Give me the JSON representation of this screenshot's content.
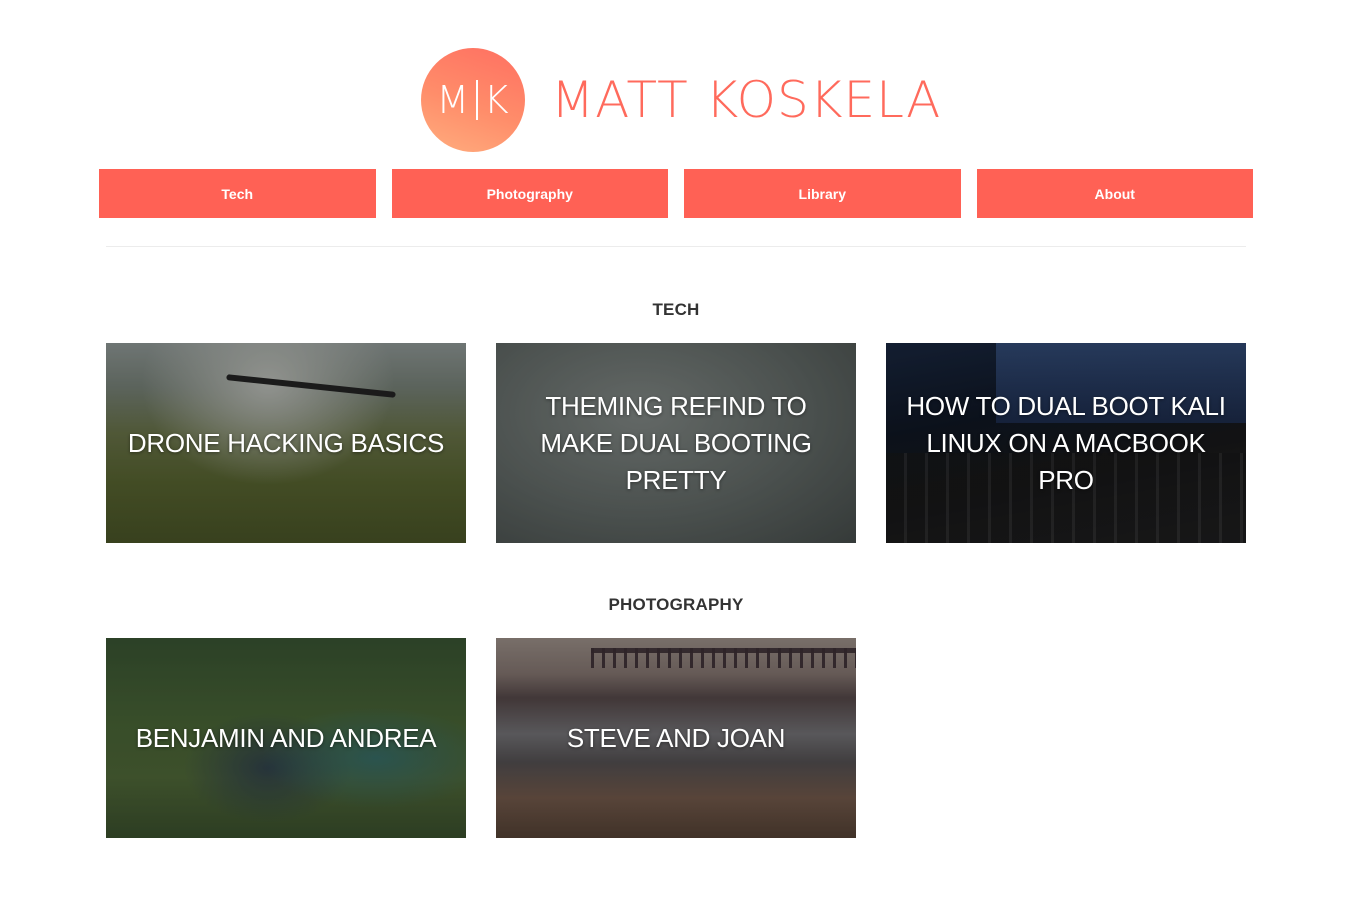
{
  "header": {
    "logo_initial_left": "M",
    "logo_initial_right": "K",
    "site_name": "MATT KOSKELA"
  },
  "nav": {
    "items": [
      {
        "label": "Tech"
      },
      {
        "label": "Photography"
      },
      {
        "label": "Library"
      },
      {
        "label": "About"
      }
    ]
  },
  "sections": {
    "tech": {
      "title": "TECH",
      "posts": [
        {
          "title": "DRONE HACKING BASICS"
        },
        {
          "title": "THEMING REFIND TO MAKE DUAL BOOTING PRETTY"
        },
        {
          "title": "HOW TO DUAL BOOT KALI LINUX ON A MACBOOK PRO"
        }
      ]
    },
    "photography": {
      "title": "PHOTOGRAPHY",
      "posts": [
        {
          "title": "BENJAMIN AND ANDREA"
        },
        {
          "title": "STEVE AND JOAN"
        }
      ]
    }
  },
  "colors": {
    "accent": "#ff6155",
    "brand_text": "#ff6a5c"
  }
}
